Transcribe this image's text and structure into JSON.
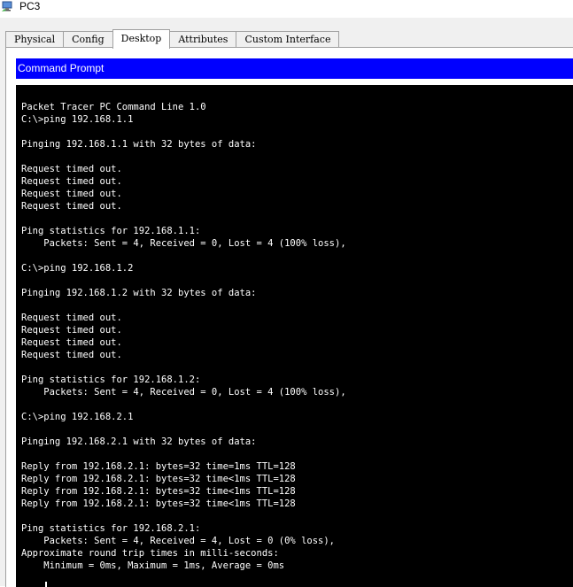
{
  "window": {
    "title": "PC3"
  },
  "tabs": [
    {
      "label": "Physical"
    },
    {
      "label": "Config"
    },
    {
      "label": "Desktop"
    },
    {
      "label": "Attributes"
    },
    {
      "label": "Custom Interface"
    }
  ],
  "active_tab": "Desktop",
  "command_prompt": {
    "title": "Command Prompt",
    "lines": [
      "Packet Tracer PC Command Line 1.0",
      "C:\\>ping 192.168.1.1",
      "",
      "Pinging 192.168.1.1 with 32 bytes of data:",
      "",
      "Request timed out.",
      "Request timed out.",
      "Request timed out.",
      "Request timed out.",
      "",
      "Ping statistics for 192.168.1.1:",
      "    Packets: Sent = 4, Received = 0, Lost = 4 (100% loss),",
      "",
      "C:\\>ping 192.168.1.2",
      "",
      "Pinging 192.168.1.2 with 32 bytes of data:",
      "",
      "Request timed out.",
      "Request timed out.",
      "Request timed out.",
      "Request timed out.",
      "",
      "Ping statistics for 192.168.1.2:",
      "    Packets: Sent = 4, Received = 0, Lost = 4 (100% loss),",
      "",
      "C:\\>ping 192.168.2.1",
      "",
      "Pinging 192.168.2.1 with 32 bytes of data:",
      "",
      "Reply from 192.168.2.1: bytes=32 time=1ms TTL=128",
      "Reply from 192.168.2.1: bytes=32 time<1ms TTL=128",
      "Reply from 192.168.2.1: bytes=32 time<1ms TTL=128",
      "Reply from 192.168.2.1: bytes=32 time<1ms TTL=128",
      "",
      "Ping statistics for 192.168.2.1:",
      "    Packets: Sent = 4, Received = 4, Lost = 0 (0% loss),",
      "Approximate round trip times in milli-seconds:",
      "    Minimum = 0ms, Maximum = 1ms, Average = 0ms"
    ]
  },
  "colors": {
    "header_bg": "#0000ff",
    "terminal_bg": "#000000",
    "terminal_fg": "#ffffff"
  },
  "icons": {
    "app": "pc-icon"
  }
}
